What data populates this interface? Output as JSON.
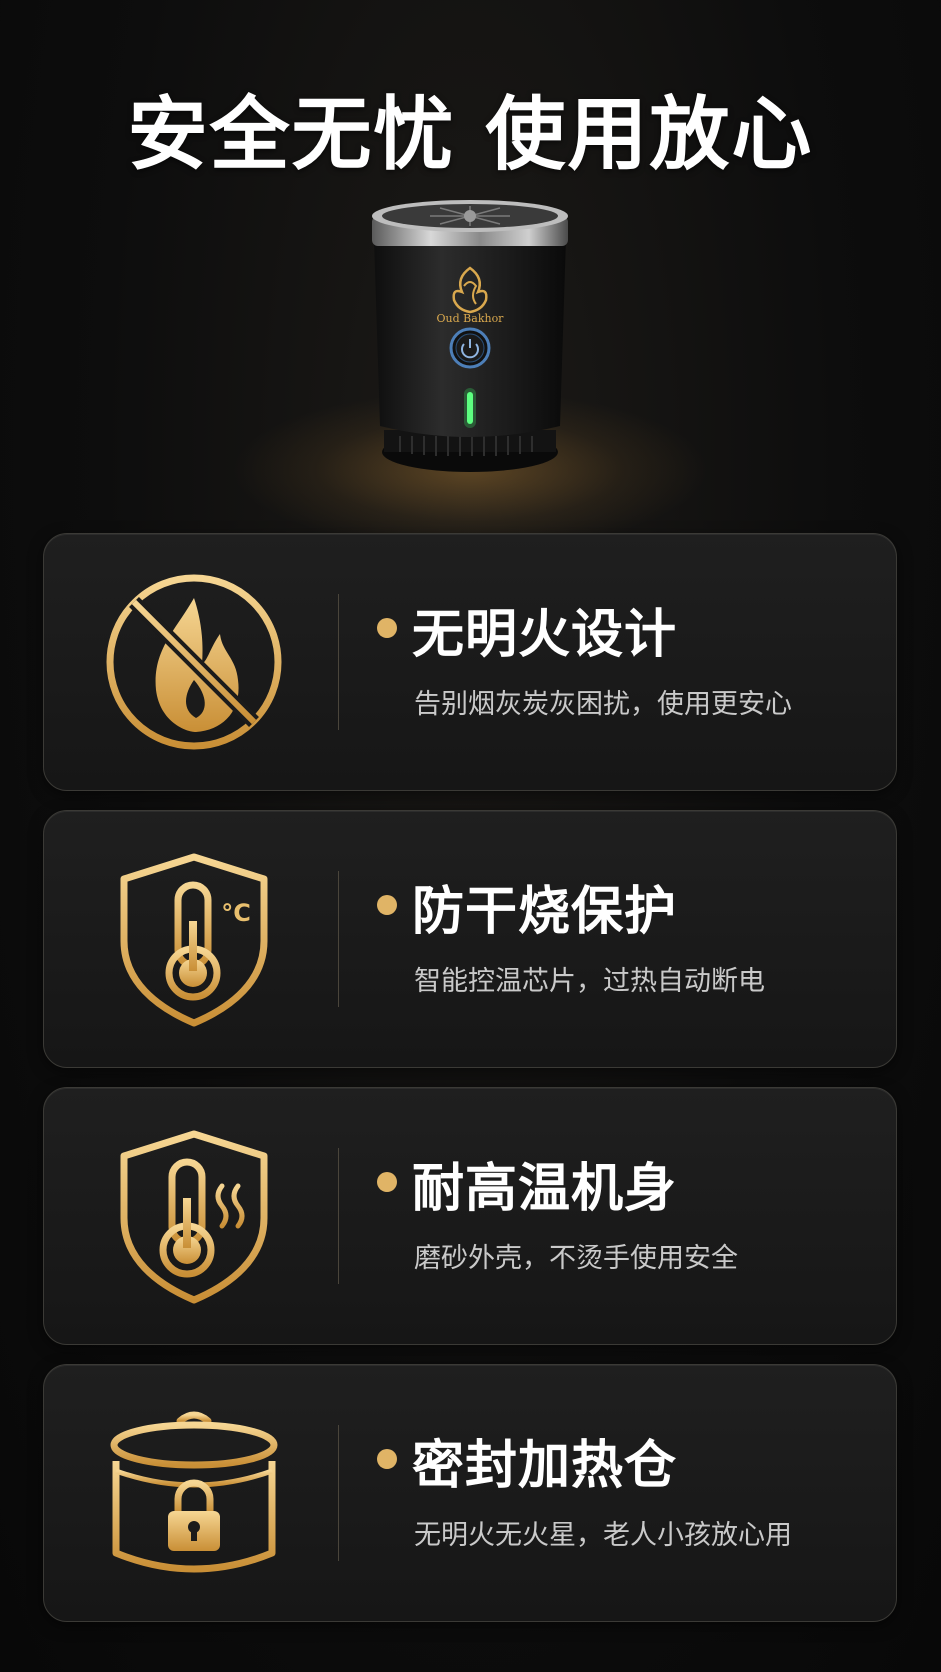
{
  "title": "安全无忧 使用放心",
  "product": {
    "brand": "Oud Bakhor"
  },
  "colors": {
    "gold": "#e0b466",
    "gold_light": "#f3d08a",
    "background": "#0d0d0d",
    "card": "#1a1a1a",
    "led": "#3cff6a"
  },
  "features": [
    {
      "icon": "no-flame-icon",
      "heading": "无明火设计",
      "sub": "告别烟灰炭灰困扰，使用更安心"
    },
    {
      "icon": "shield-thermometer-celsius-icon",
      "heading": "防干烧保护",
      "sub": "智能控温芯片，过热自动断电",
      "icon_text": "°C"
    },
    {
      "icon": "shield-thermometer-heat-icon",
      "heading": "耐高温机身",
      "sub": "磨砂外壳，不烫手使用安全"
    },
    {
      "icon": "sealed-pot-lock-icon",
      "heading": "密封加热仓",
      "sub": "无明火无火星，老人小孩放心用"
    }
  ]
}
